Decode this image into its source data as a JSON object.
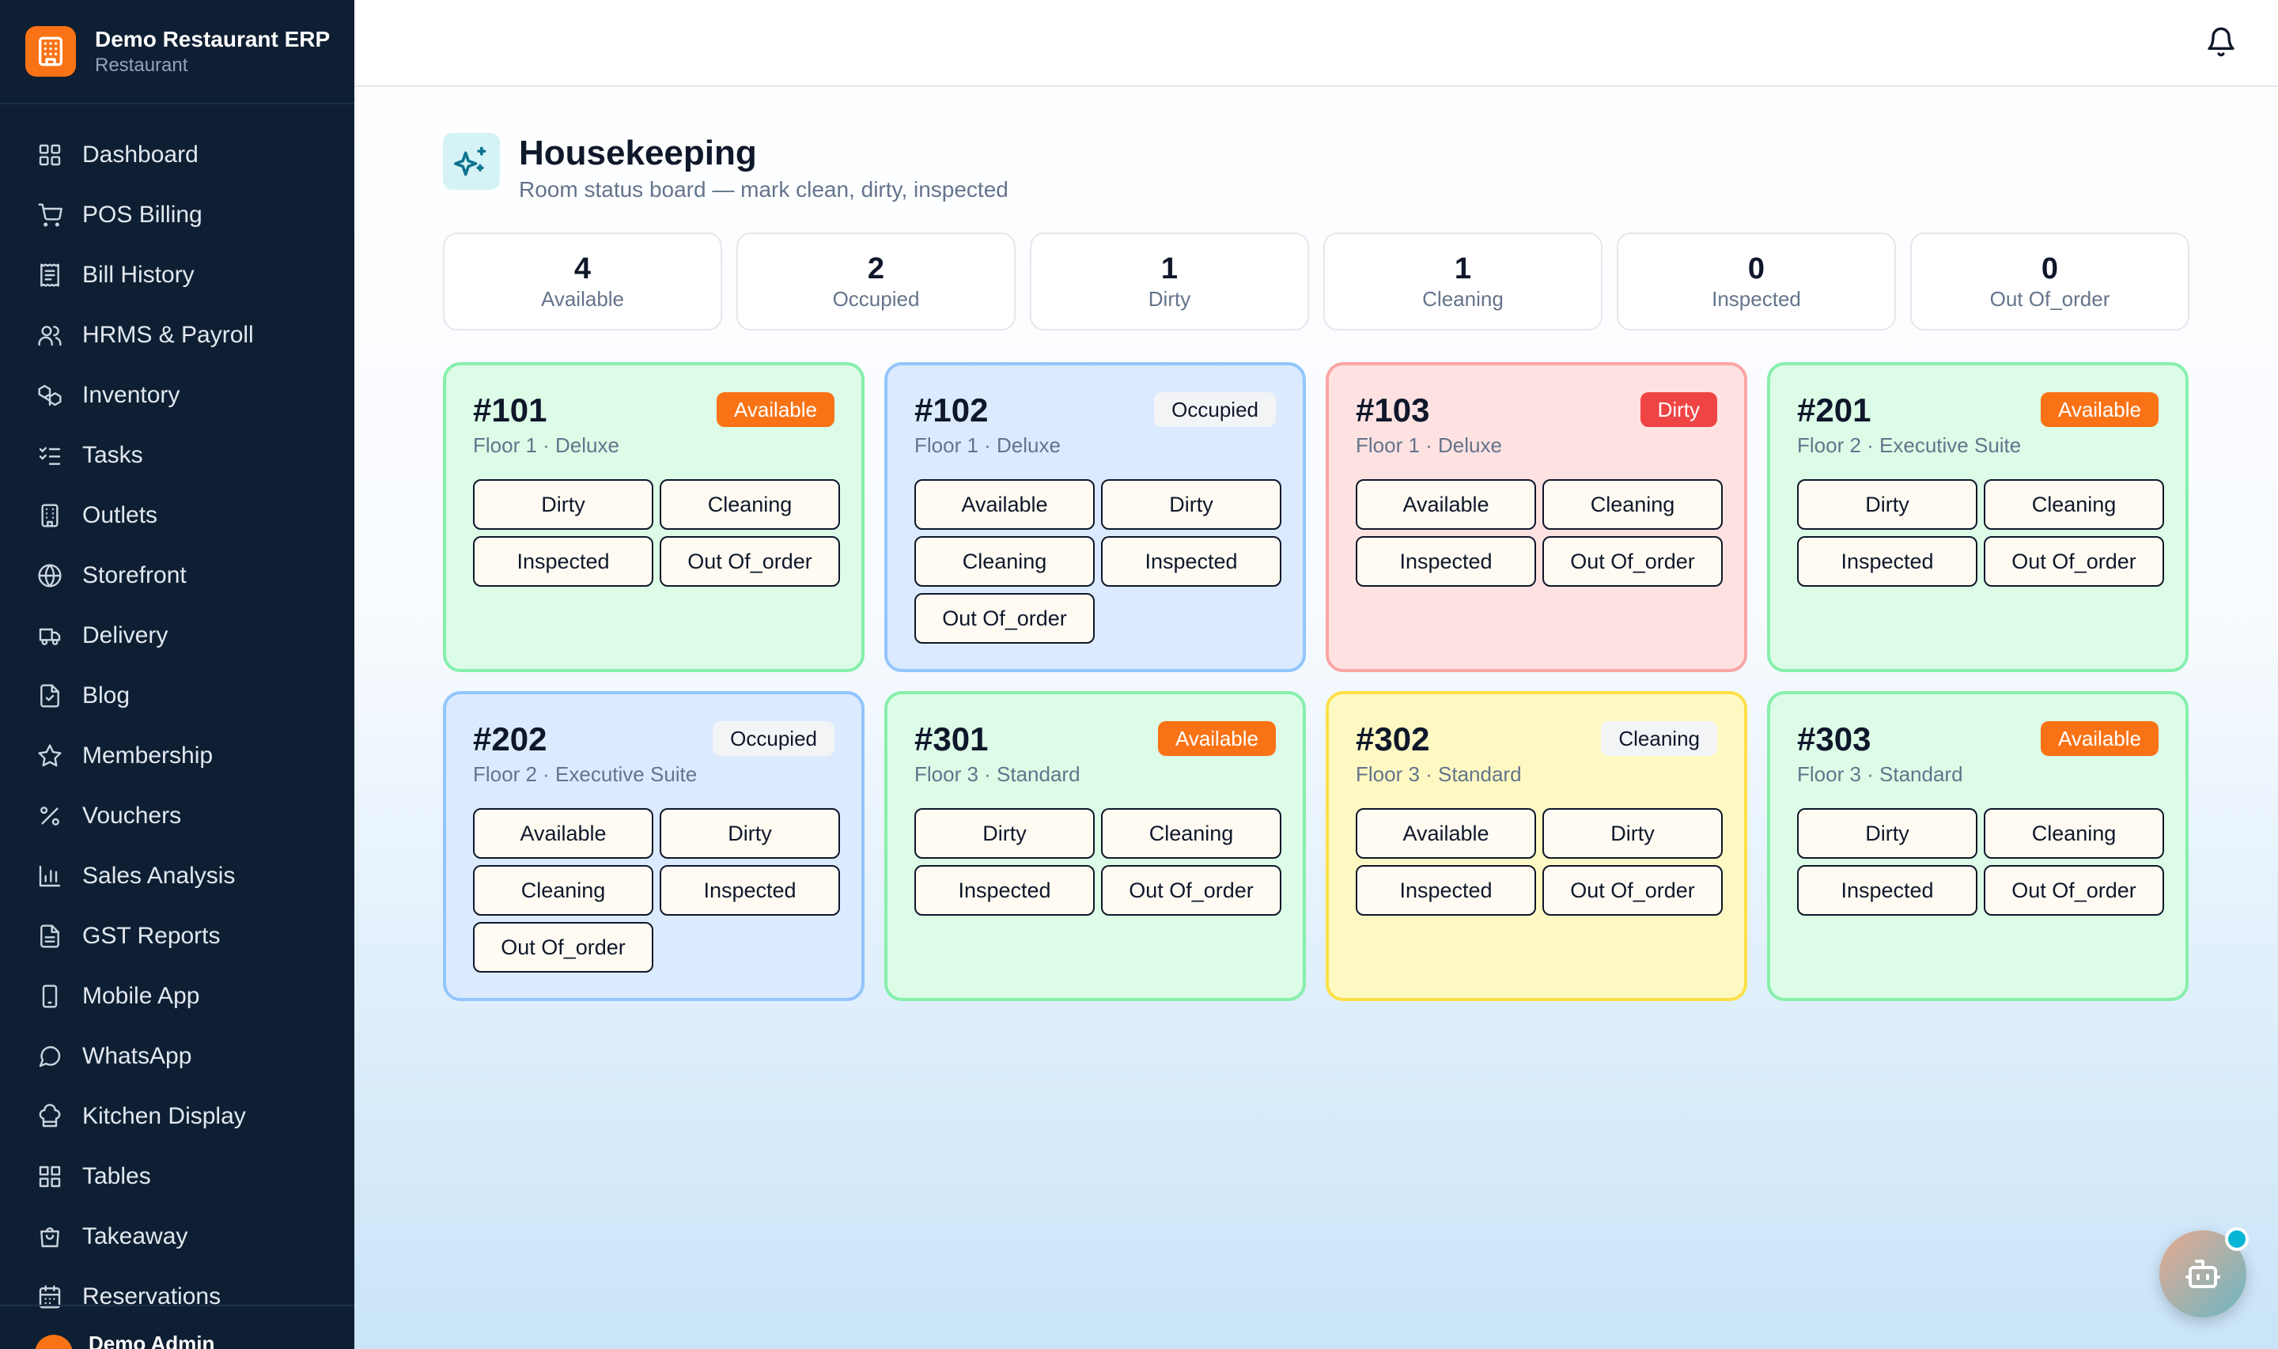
{
  "brand": {
    "name": "Demo Restaurant ERP",
    "sub": "Restaurant"
  },
  "sidebar": {
    "items": [
      {
        "label": "Dashboard",
        "icon": "dashboard-icon"
      },
      {
        "label": "POS Billing",
        "icon": "cart-icon"
      },
      {
        "label": "Bill History",
        "icon": "receipt-icon"
      },
      {
        "label": "HRMS & Payroll",
        "icon": "users-icon"
      },
      {
        "label": "Inventory",
        "icon": "boxes-icon"
      },
      {
        "label": "Tasks",
        "icon": "checklist-icon"
      },
      {
        "label": "Outlets",
        "icon": "building-icon"
      },
      {
        "label": "Storefront",
        "icon": "globe-icon"
      },
      {
        "label": "Delivery",
        "icon": "truck-icon"
      },
      {
        "label": "Blog",
        "icon": "document-icon"
      },
      {
        "label": "Membership",
        "icon": "star-icon"
      },
      {
        "label": "Vouchers",
        "icon": "percent-icon"
      },
      {
        "label": "Sales Analysis",
        "icon": "bar-chart-icon"
      },
      {
        "label": "GST Reports",
        "icon": "report-icon"
      },
      {
        "label": "Mobile App",
        "icon": "phone-icon"
      },
      {
        "label": "WhatsApp",
        "icon": "chat-icon"
      },
      {
        "label": "Kitchen Display",
        "icon": "chef-hat-icon"
      },
      {
        "label": "Tables",
        "icon": "grid-icon"
      },
      {
        "label": "Takeaway",
        "icon": "bag-icon"
      },
      {
        "label": "Reservations",
        "icon": "calendar-icon"
      }
    ],
    "footer": {
      "name": "Demo Admin"
    }
  },
  "page": {
    "title": "Housekeeping",
    "subtitle": "Room status board — mark clean, dirty, inspected"
  },
  "stats": [
    {
      "value": "4",
      "label": "Available"
    },
    {
      "value": "2",
      "label": "Occupied"
    },
    {
      "value": "1",
      "label": "Dirty"
    },
    {
      "value": "1",
      "label": "Cleaning"
    },
    {
      "value": "0",
      "label": "Inspected"
    },
    {
      "value": "0",
      "label": "Out Of_order"
    }
  ],
  "rooms": [
    {
      "number": "#101",
      "meta": "Floor 1 · Deluxe",
      "status": "Available",
      "actions": [
        "Dirty",
        "Cleaning",
        "Inspected",
        "Out Of_order"
      ]
    },
    {
      "number": "#102",
      "meta": "Floor 1 · Deluxe",
      "status": "Occupied",
      "actions": [
        "Available",
        "Dirty",
        "Cleaning",
        "Inspected",
        "Out Of_order"
      ]
    },
    {
      "number": "#103",
      "meta": "Floor 1 · Deluxe",
      "status": "Dirty",
      "actions": [
        "Available",
        "Cleaning",
        "Inspected",
        "Out Of_order"
      ]
    },
    {
      "number": "#201",
      "meta": "Floor 2 · Executive Suite",
      "status": "Available",
      "actions": [
        "Dirty",
        "Cleaning",
        "Inspected",
        "Out Of_order"
      ]
    },
    {
      "number": "#202",
      "meta": "Floor 2 · Executive Suite",
      "status": "Occupied",
      "actions": [
        "Available",
        "Dirty",
        "Cleaning",
        "Inspected",
        "Out Of_order"
      ]
    },
    {
      "number": "#301",
      "meta": "Floor 3 · Standard",
      "status": "Available",
      "actions": [
        "Dirty",
        "Cleaning",
        "Inspected",
        "Out Of_order"
      ]
    },
    {
      "number": "#302",
      "meta": "Floor 3 · Standard",
      "status": "Cleaning",
      "actions": [
        "Available",
        "Dirty",
        "Inspected",
        "Out Of_order"
      ]
    },
    {
      "number": "#303",
      "meta": "Floor 3 · Standard",
      "status": "Available",
      "actions": [
        "Dirty",
        "Cleaning",
        "Inspected",
        "Out Of_order"
      ]
    }
  ],
  "colors": {
    "sidebar_bg": "#0f1f33",
    "accent": "#f97316",
    "available_bg": "#dcfce7",
    "occupied_bg": "#dbeafe",
    "dirty_bg": "#fee2e2",
    "cleaning_bg": "#fef9c3",
    "dirty_badge": "#ef4444"
  },
  "icons": {
    "topbar": "bell-icon",
    "page": "sparkles-icon",
    "assistant": "robot-icon"
  }
}
